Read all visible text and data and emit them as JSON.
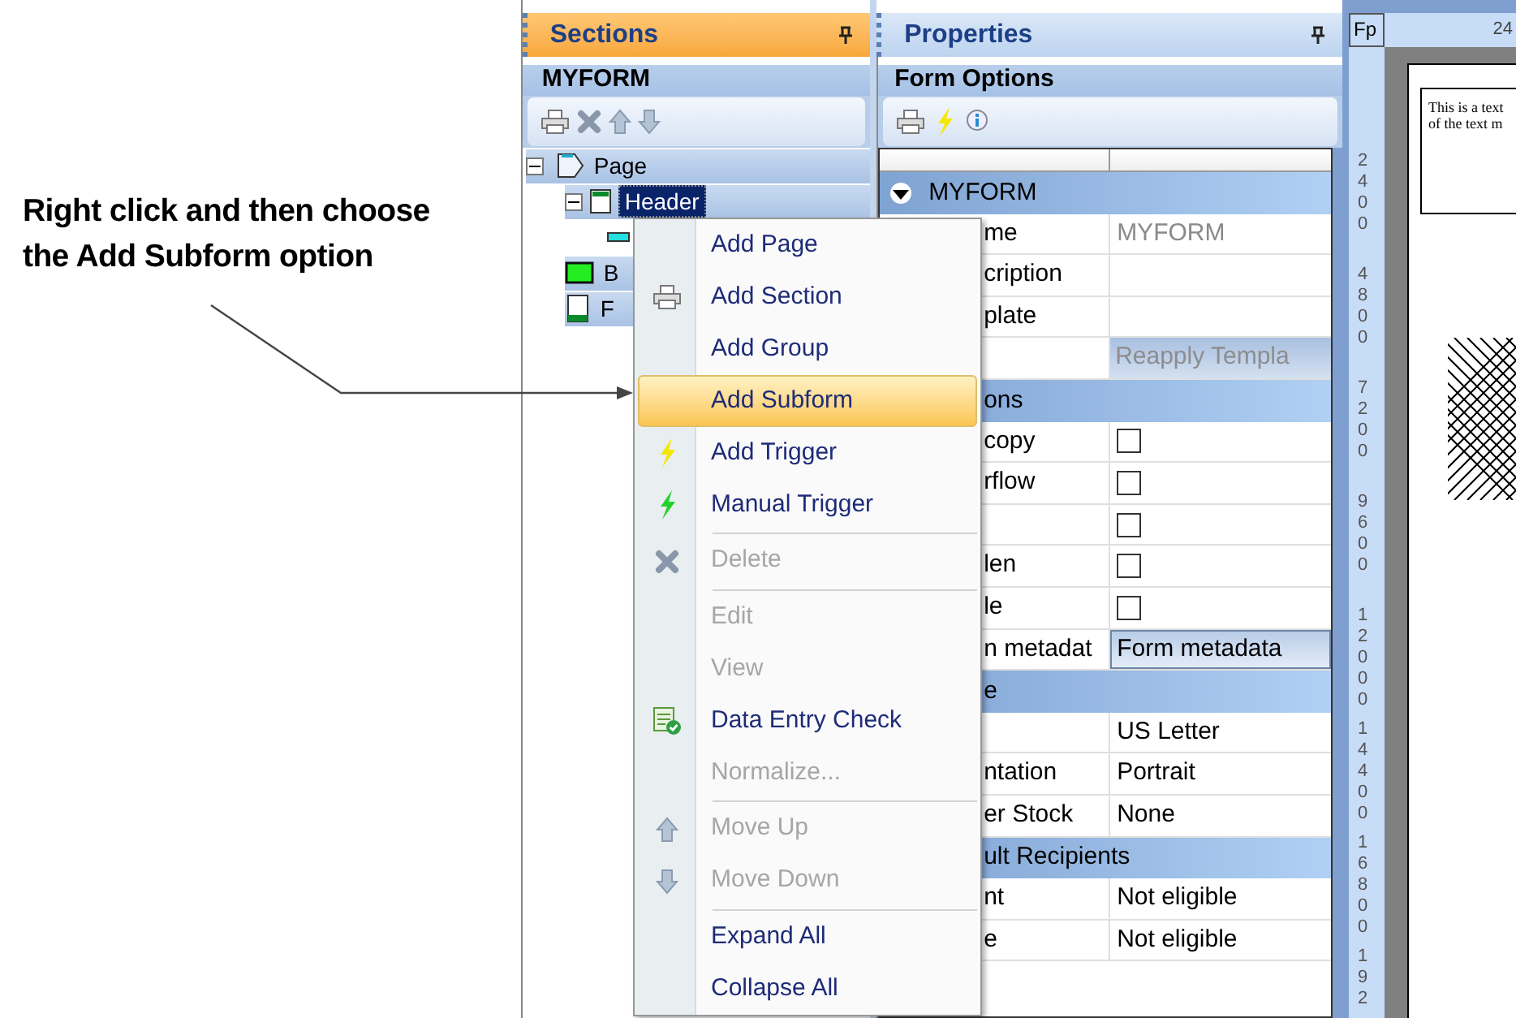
{
  "annotation": {
    "text": "Right click and then choose the Add Subform option"
  },
  "sections_panel": {
    "title": "Sections",
    "form_name": "MYFORM",
    "tree": [
      {
        "label": "Page",
        "kind": "page",
        "expanded": true,
        "selected": false,
        "children": [
          {
            "label": "Header",
            "kind": "header",
            "expanded": true,
            "selected": true,
            "children": [
              {
                "kind": "field"
              }
            ]
          },
          {
            "label": "B",
            "kind": "body",
            "selected": false
          },
          {
            "label": "F",
            "kind": "footer",
            "selected": false
          }
        ]
      }
    ]
  },
  "properties_panel": {
    "title": "Properties",
    "subtitle": "Form Options",
    "rows": [
      {
        "kind": "category",
        "label": "MYFORM",
        "expanded": true
      },
      {
        "kind": "readonly",
        "label": "me",
        "value": "MYFORM"
      },
      {
        "kind": "text",
        "label": "cription"
      },
      {
        "kind": "text",
        "label": "plate"
      },
      {
        "kind": "button",
        "value": "Reapply Templa"
      },
      {
        "kind": "category",
        "label": "ons"
      },
      {
        "kind": "checkbox",
        "label": "copy",
        "checked": false
      },
      {
        "kind": "checkbox",
        "label": "rflow",
        "checked": false
      },
      {
        "kind": "checkbox",
        "checked": false
      },
      {
        "kind": "checkbox",
        "label": "len",
        "checked": false
      },
      {
        "kind": "checkbox",
        "label": "le",
        "checked": false
      },
      {
        "kind": "dropdown",
        "label": "n metadat",
        "value": "Form metadata"
      },
      {
        "kind": "category",
        "label": "e"
      },
      {
        "kind": "text",
        "value": "US Letter"
      },
      {
        "kind": "text",
        "label": "ntation",
        "value": "Portrait"
      },
      {
        "kind": "text",
        "label": "er Stock",
        "value": "None"
      },
      {
        "kind": "category",
        "label": "ult Recipients"
      },
      {
        "kind": "text",
        "label": "nt",
        "value": "Not eligible"
      },
      {
        "kind": "text",
        "label": "e",
        "value": "Not eligible"
      }
    ]
  },
  "context_menu": {
    "items": [
      {
        "kind": "item",
        "label": "Add Page",
        "disabled": false,
        "selected": false
      },
      {
        "kind": "item",
        "label": "Add Section",
        "disabled": false,
        "selected": false
      },
      {
        "kind": "item",
        "label": "Add Group",
        "disabled": false,
        "selected": false
      },
      {
        "kind": "item",
        "label": "Add Subform",
        "disabled": false,
        "selected": true
      },
      {
        "kind": "item",
        "label": "Add Trigger",
        "disabled": false,
        "selected": false
      },
      {
        "kind": "item",
        "label": "Manual Trigger",
        "disabled": false,
        "selected": false
      },
      {
        "kind": "separator"
      },
      {
        "kind": "item",
        "label": "Delete",
        "disabled": true,
        "selected": false
      },
      {
        "kind": "separator"
      },
      {
        "kind": "item",
        "label": "Edit",
        "disabled": true,
        "selected": false
      },
      {
        "kind": "item",
        "label": "View",
        "disabled": true,
        "selected": false
      },
      {
        "kind": "item",
        "label": "Data Entry Check",
        "disabled": false,
        "selected": false
      },
      {
        "kind": "item",
        "label": "Normalize...",
        "disabled": true,
        "selected": false
      },
      {
        "kind": "separator"
      },
      {
        "kind": "item",
        "label": "Move Up",
        "disabled": true,
        "selected": false
      },
      {
        "kind": "item",
        "label": "Move Down",
        "disabled": true,
        "selected": false
      },
      {
        "kind": "separator"
      },
      {
        "kind": "item",
        "label": "Expand All",
        "disabled": false,
        "selected": false
      },
      {
        "kind": "item",
        "label": "Collapse All",
        "disabled": false,
        "selected": false
      }
    ]
  },
  "ruler": {
    "corner": "Fp",
    "top_label": "24",
    "vertical_labels": [
      "2400",
      "4800",
      "7200",
      "9600",
      "12000",
      "14400",
      "16800",
      "192"
    ]
  },
  "canvas": {
    "text_lines": [
      "This is a text",
      "of the text m"
    ]
  }
}
